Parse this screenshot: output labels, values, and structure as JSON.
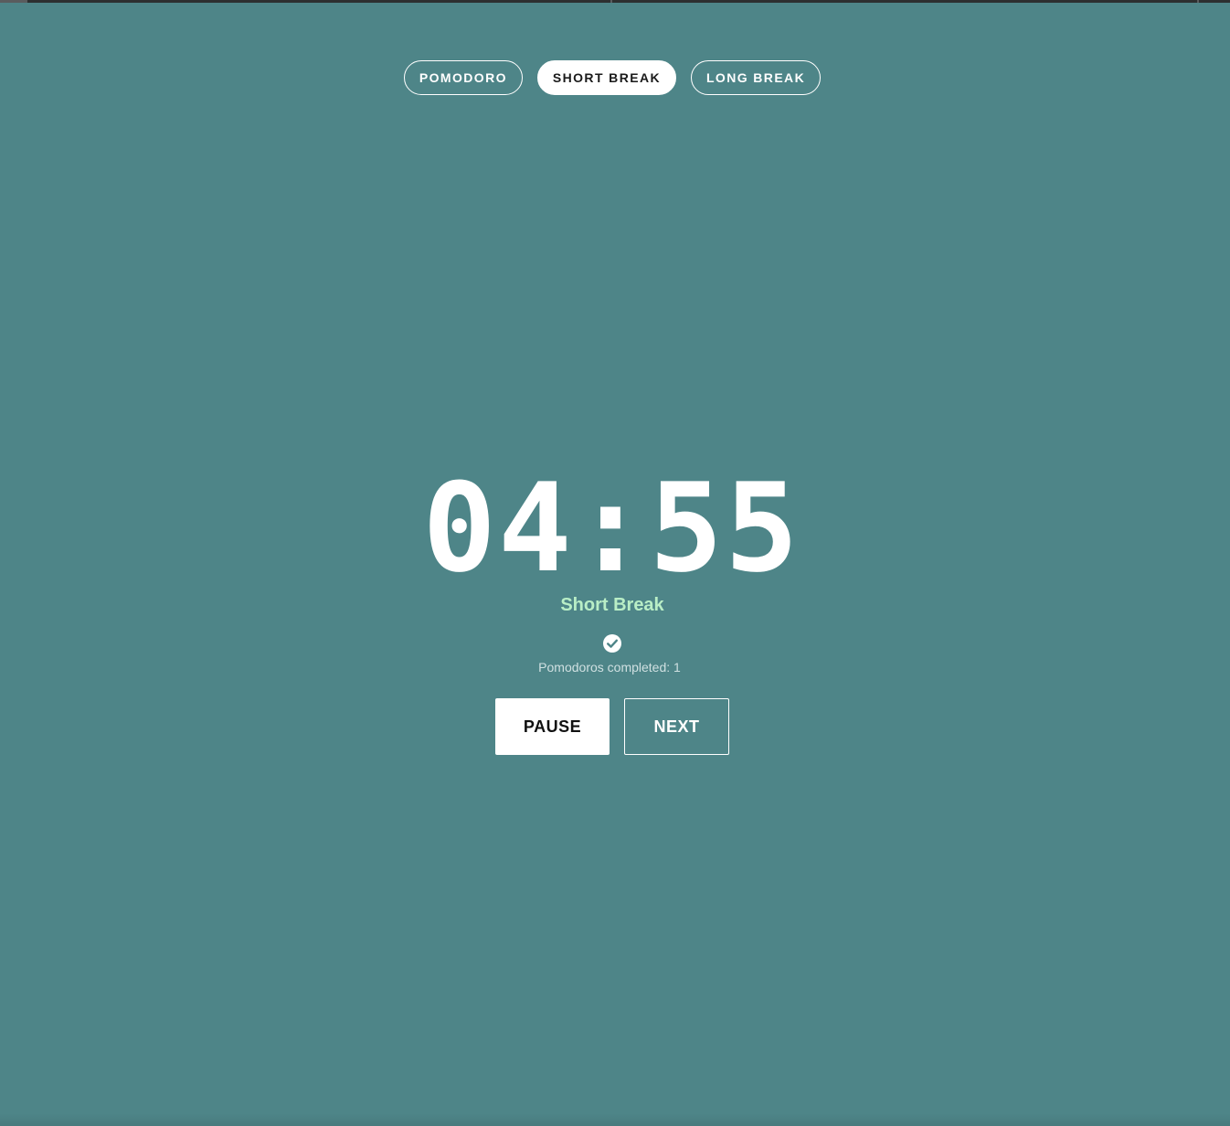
{
  "tabs": [
    {
      "label": "POMODORO",
      "active": false
    },
    {
      "label": "SHORT BREAK",
      "active": true
    },
    {
      "label": "LONG BREAK",
      "active": false
    }
  ],
  "timer": {
    "display": "04:55",
    "mode_label": "Short Break"
  },
  "progress": {
    "icon": "check-circle-icon",
    "completed_text": "Pomodoros completed: 1"
  },
  "controls": {
    "pause_label": "PAUSE",
    "next_label": "NEXT"
  },
  "colors": {
    "background": "#4e8588",
    "mode_label": "#b9eec6",
    "button_text_dark": "#111111"
  }
}
